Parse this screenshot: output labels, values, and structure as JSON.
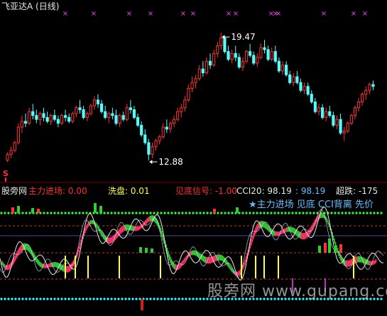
{
  "window": {
    "title": "飞亚达A (日线)"
  },
  "top_panel": {
    "high_label": "19.47",
    "low_label": "12.88",
    "signal_mark": "S"
  },
  "indicator_panel": {
    "source_logo": "股旁网",
    "readouts": {
      "main_entry": "主力进场: 0.00",
      "wash": "洗盘: 0.01",
      "bottom_signal": "见底信号: -1.00",
      "cci": "CCI20: 98.19",
      "cci2": ": 98.19",
      "oversold": "超跌: -175"
    },
    "legend": "★主力进场  见底  CCI背离  先价"
  },
  "footer_watermark": "股旁网 www.gupang.com",
  "colors": {
    "up": "#ff3333",
    "down": "#53ffff",
    "marker": "#ff40ff",
    "green_band": "#33cc33",
    "pink_band": "#ff3366",
    "yellow": "#ffff33",
    "dotted": "#33ff33",
    "cyan_dotted": "#33ffff"
  },
  "chart_data": [
    {
      "type": "candlestick",
      "title": "飞亚达A (日线)",
      "ylim": [
        12.0,
        20.5
      ],
      "annotations": [
        {
          "label": "19.47",
          "value": 19.47
        },
        {
          "label": "12.88",
          "value": 12.88
        }
      ],
      "ohlc": [
        [
          12.9,
          13.3,
          12.8,
          13.2
        ],
        [
          13.2,
          13.6,
          13.0,
          13.4
        ],
        [
          13.4,
          13.9,
          13.3,
          13.8
        ],
        [
          13.8,
          14.8,
          13.7,
          14.6
        ],
        [
          14.6,
          15.2,
          14.3,
          14.9
        ],
        [
          14.9,
          15.3,
          14.6,
          14.8
        ],
        [
          14.8,
          15.6,
          14.7,
          15.4
        ],
        [
          15.4,
          15.8,
          15.0,
          15.2
        ],
        [
          15.2,
          15.5,
          14.8,
          15.0
        ],
        [
          15.0,
          15.4,
          14.7,
          15.3
        ],
        [
          15.3,
          15.6,
          14.9,
          15.1
        ],
        [
          15.1,
          15.4,
          14.8,
          14.9
        ],
        [
          14.9,
          15.3,
          14.7,
          15.2
        ],
        [
          15.2,
          15.5,
          14.9,
          15.0
        ],
        [
          15.0,
          15.2,
          14.6,
          14.8
        ],
        [
          14.8,
          15.3,
          14.7,
          15.2
        ],
        [
          15.2,
          15.5,
          14.9,
          15.1
        ],
        [
          15.1,
          15.3,
          14.8,
          14.9
        ],
        [
          14.9,
          15.4,
          14.8,
          15.3
        ],
        [
          15.3,
          15.7,
          15.1,
          15.6
        ],
        [
          15.6,
          16.0,
          15.3,
          15.5
        ],
        [
          15.5,
          15.7,
          15.0,
          15.1
        ],
        [
          15.1,
          15.4,
          14.9,
          15.3
        ],
        [
          15.3,
          15.8,
          15.2,
          15.7
        ],
        [
          15.7,
          16.2,
          15.5,
          16.0
        ],
        [
          16.0,
          16.3,
          15.6,
          15.8
        ],
        [
          15.8,
          16.0,
          15.3,
          15.4
        ],
        [
          15.4,
          15.7,
          15.0,
          15.1
        ],
        [
          15.1,
          15.4,
          14.8,
          15.3
        ],
        [
          15.3,
          15.6,
          15.0,
          15.2
        ],
        [
          15.2,
          15.5,
          14.7,
          14.8
        ],
        [
          14.8,
          15.3,
          14.6,
          15.2
        ],
        [
          15.2,
          15.4,
          14.9,
          15.0
        ],
        [
          15.0,
          15.8,
          14.9,
          15.6
        ],
        [
          15.6,
          16.0,
          15.3,
          15.5
        ],
        [
          15.5,
          15.7,
          15.0,
          15.1
        ],
        [
          15.1,
          15.3,
          14.6,
          14.7
        ],
        [
          14.7,
          14.9,
          14.1,
          14.2
        ],
        [
          14.2,
          14.5,
          13.7,
          13.8
        ],
        [
          13.8,
          14.0,
          12.88,
          13.2
        ],
        [
          13.2,
          13.8,
          13.0,
          13.6
        ],
        [
          13.6,
          14.0,
          13.4,
          13.9
        ],
        [
          13.9,
          14.2,
          13.7,
          14.1
        ],
        [
          14.1,
          14.8,
          14.0,
          14.6
        ],
        [
          14.6,
          15.0,
          14.3,
          14.5
        ],
        [
          14.5,
          14.9,
          14.3,
          14.8
        ],
        [
          14.8,
          15.2,
          14.6,
          15.0
        ],
        [
          15.0,
          15.6,
          14.9,
          15.4
        ],
        [
          15.4,
          15.8,
          15.1,
          15.6
        ],
        [
          15.6,
          16.2,
          15.4,
          16.0
        ],
        [
          16.0,
          16.8,
          15.9,
          16.6
        ],
        [
          16.6,
          17.2,
          16.4,
          16.9
        ],
        [
          16.9,
          17.3,
          16.6,
          17.1
        ],
        [
          17.1,
          17.8,
          17.0,
          17.6
        ],
        [
          17.6,
          18.0,
          17.2,
          17.4
        ],
        [
          17.4,
          18.2,
          17.3,
          18.0
        ],
        [
          18.0,
          18.4,
          17.6,
          17.8
        ],
        [
          17.8,
          18.6,
          17.7,
          18.4
        ],
        [
          18.4,
          19.0,
          18.2,
          18.8
        ],
        [
          18.8,
          19.47,
          18.6,
          19.2
        ],
        [
          19.2,
          19.3,
          18.4,
          18.5
        ],
        [
          18.5,
          18.8,
          18.0,
          18.1
        ],
        [
          18.1,
          18.6,
          17.9,
          18.4
        ],
        [
          18.4,
          18.8,
          18.0,
          18.2
        ],
        [
          18.2,
          18.4,
          17.6,
          17.7
        ],
        [
          17.7,
          18.2,
          17.5,
          18.0
        ],
        [
          18.0,
          18.6,
          17.9,
          18.5
        ],
        [
          18.5,
          18.9,
          18.2,
          18.3
        ],
        [
          18.3,
          18.5,
          17.8,
          17.9
        ],
        [
          17.9,
          18.4,
          17.7,
          18.2
        ],
        [
          18.2,
          18.9,
          18.1,
          18.7
        ],
        [
          18.7,
          19.1,
          18.4,
          18.6
        ],
        [
          18.6,
          18.8,
          18.0,
          18.1
        ],
        [
          18.1,
          18.7,
          18.0,
          18.5
        ],
        [
          18.5,
          18.8,
          17.9,
          18.0
        ],
        [
          18.0,
          18.2,
          17.4,
          17.5
        ],
        [
          17.5,
          18.0,
          17.3,
          17.8
        ],
        [
          17.8,
          18.0,
          17.2,
          17.3
        ],
        [
          17.3,
          17.5,
          16.8,
          16.9
        ],
        [
          16.9,
          17.4,
          16.7,
          17.2
        ],
        [
          17.2,
          17.5,
          16.8,
          16.9
        ],
        [
          16.9,
          17.1,
          16.4,
          16.5
        ],
        [
          16.5,
          16.9,
          16.3,
          16.7
        ],
        [
          16.7,
          16.9,
          16.2,
          16.3
        ],
        [
          16.3,
          16.5,
          15.8,
          15.9
        ],
        [
          15.9,
          16.1,
          15.3,
          15.4
        ],
        [
          15.4,
          15.8,
          15.2,
          15.6
        ],
        [
          15.6,
          15.8,
          15.0,
          15.1
        ],
        [
          15.1,
          15.6,
          14.9,
          15.4
        ],
        [
          15.4,
          15.7,
          15.1,
          15.2
        ],
        [
          15.2,
          15.4,
          14.6,
          14.7
        ],
        [
          14.7,
          15.2,
          14.5,
          15.0
        ],
        [
          15.0,
          15.3,
          14.2,
          14.3
        ],
        [
          14.3,
          14.6,
          13.9,
          14.4
        ],
        [
          14.4,
          14.9,
          14.3,
          14.8
        ],
        [
          14.8,
          15.3,
          14.7,
          15.2
        ],
        [
          15.2,
          15.7,
          15.0,
          15.6
        ],
        [
          15.6,
          16.1,
          15.4,
          15.9
        ],
        [
          15.9,
          16.4,
          15.7,
          16.3
        ],
        [
          16.3,
          16.7,
          16.0,
          16.5
        ],
        [
          16.5,
          16.9,
          16.3,
          16.8
        ],
        [
          16.8,
          17.0,
          16.5,
          16.7
        ]
      ]
    },
    {
      "type": "line",
      "title": "",
      "series_names": [
        "主力进场",
        "洗盘",
        "见底信号",
        "CCI20",
        "超跌"
      ],
      "levels": [
        100,
        50,
        0,
        -100,
        -175
      ]
    }
  ]
}
